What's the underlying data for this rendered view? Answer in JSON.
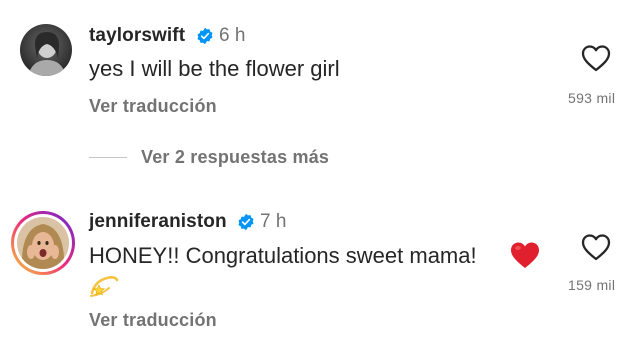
{
  "comments": [
    {
      "username": "taylorswift",
      "timestamp": "6 h",
      "text": "yes I will be the flower girl",
      "translate_label": "Ver traducción",
      "likes": "593 mil",
      "avatar_icon": "avatar-photo",
      "verified_icon": "verified-badge-icon"
    },
    {
      "username": "jenniferaniston",
      "timestamp": "7 h",
      "text": "HONEY!! Congratulations sweet mama!",
      "emoji_1": "heart-emoji",
      "emoji_2": "dizzy-emoji",
      "translate_label": "Ver traducción",
      "likes": "159 mil",
      "avatar_icon": "avatar-photo-story-ring",
      "verified_icon": "verified-badge-icon"
    }
  ],
  "view_replies": {
    "label": "Ver 2 respuestas más"
  },
  "colors": {
    "verified": "#0095f6",
    "secondary_text": "#737373",
    "primary_text": "#262626",
    "heart_emoji": "#e0202e",
    "story_ring_start": "#f9ce34",
    "story_ring_mid": "#ee2a7b",
    "story_ring_end": "#6228d7"
  }
}
